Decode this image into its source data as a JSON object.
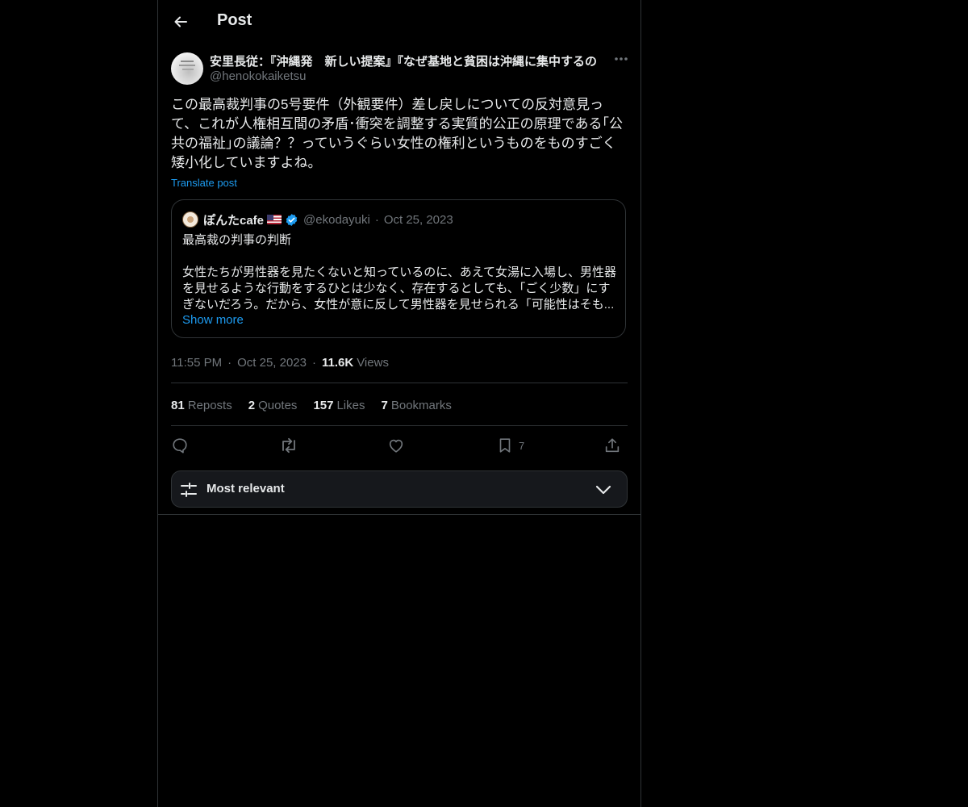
{
  "header": {
    "title": "Post"
  },
  "author": {
    "name": "安里長従：『沖縄発　新しい提案』『なぜ基地と貧困は沖縄に集中するの",
    "handle": "@henokokaiketsu"
  },
  "post": {
    "text": "この最高裁判事の5号要件（外観要件）差し戻しについての反対意見って、これが人権相互間の矛盾･衝突を調整する実質的公正の原理である｢公共の福祉｣の議論？？っていうぐらい女性の権利というものをものすごく矮小化していますよね。",
    "translate_label": "Translate post"
  },
  "quote": {
    "name": "ぽんたcafe",
    "handle": "@ekodayuki",
    "date": "Oct 25, 2023",
    "line1": "最高裁の判事の判断",
    "line2": "女性たちが男性器を見たくないと知っているのに、あえて女湯に入場し、男性器",
    "line3": "を見せるような行動をするひとは少なく、存在するとしても、「ごく少数」にす",
    "line4": "ぎないだろう。だから、女性が意に反して男性器を見せられる「可能性はそも...",
    "show_more": "Show more"
  },
  "meta": {
    "time": "11:55 PM",
    "date": "Oct 25, 2023",
    "views_count": "11.6K",
    "views_label": "Views"
  },
  "stats": {
    "reposts_num": "81",
    "reposts_label": "Reposts",
    "quotes_num": "2",
    "quotes_label": "Quotes",
    "likes_num": "157",
    "likes_label": "Likes",
    "bookmarks_num": "7",
    "bookmarks_label": "Bookmarks"
  },
  "actions": {
    "bookmark_count": "7"
  },
  "sort": {
    "label": "Most relevant"
  },
  "colors": {
    "background": "#000000",
    "text": "#e7e9ea",
    "muted": "#71767b",
    "link": "#1d9bf0",
    "border": "#2f3336"
  },
  "icons": [
    "back-arrow-icon",
    "more-icon",
    "verified-icon",
    "flag-icon",
    "reply-icon",
    "repost-icon",
    "like-icon",
    "bookmark-icon",
    "share-icon",
    "sliders-icon",
    "chevron-down-icon"
  ]
}
